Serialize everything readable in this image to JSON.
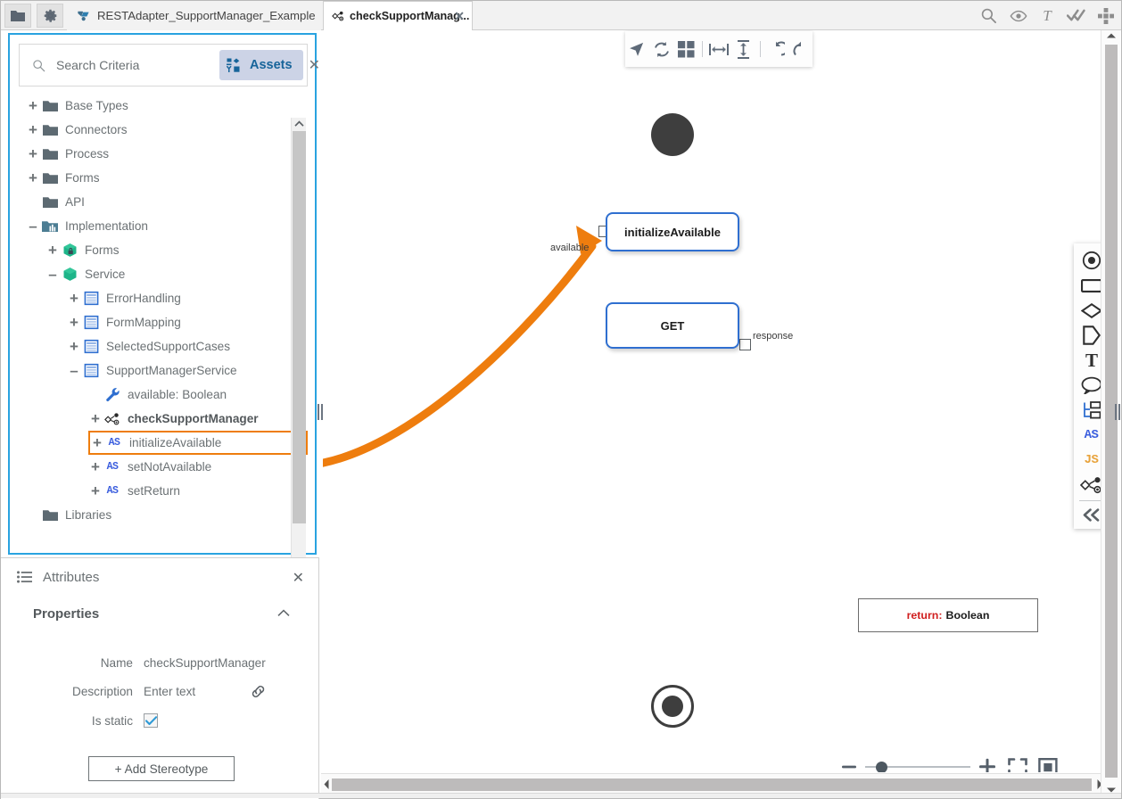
{
  "window": {
    "toolbar_buttons": [
      {
        "name": "folder-icon",
        "label": ""
      },
      {
        "name": "gear-icon",
        "label": ""
      }
    ],
    "project_tab": {
      "label": "RESTAdapter_SupportManager_Example",
      "icon": "project-icon"
    },
    "document_tab": {
      "label": "checkSupportManag...",
      "icon": "service-flow-icon",
      "close": "✕"
    },
    "top_right_icons": [
      "search-icon",
      "eye-icon",
      "text-icon",
      "double-check-icon",
      "move-icon"
    ]
  },
  "explorer": {
    "search": {
      "placeholder": "Search Criteria",
      "value": "",
      "assets_label": "Assets",
      "close": "✕"
    },
    "tree": [
      {
        "toggle": "+",
        "icon": "folder-icon",
        "label": "Base Types",
        "indent": 0,
        "bold": false,
        "selected": false
      },
      {
        "toggle": "+",
        "icon": "folder-icon",
        "label": "Connectors",
        "indent": 0,
        "bold": false,
        "selected": false
      },
      {
        "toggle": "+",
        "icon": "folder-icon",
        "label": "Process",
        "indent": 0,
        "bold": false,
        "selected": false
      },
      {
        "toggle": "+",
        "icon": "folder-icon",
        "label": "Forms",
        "indent": 0,
        "bold": false,
        "selected": false
      },
      {
        "toggle": "",
        "icon": "folder-icon",
        "label": "API",
        "indent": 0,
        "bold": false,
        "selected": false
      },
      {
        "toggle": "–",
        "icon": "folder-impl-icon",
        "label": "Implementation",
        "indent": 0,
        "bold": false,
        "selected": false
      },
      {
        "toggle": "+",
        "icon": "cube-lock-icon",
        "label": "Forms",
        "indent": 1,
        "bold": false,
        "selected": false
      },
      {
        "toggle": "–",
        "icon": "cube-icon",
        "label": "Service",
        "indent": 1,
        "bold": false,
        "selected": false
      },
      {
        "toggle": "+",
        "icon": "service-icon",
        "label": "ErrorHandling",
        "indent": 2,
        "bold": false,
        "selected": false
      },
      {
        "toggle": "+",
        "icon": "service-icon",
        "label": "FormMapping",
        "indent": 2,
        "bold": false,
        "selected": false
      },
      {
        "toggle": "+",
        "icon": "service-icon",
        "label": "SelectedSupportCases",
        "indent": 2,
        "bold": false,
        "selected": false
      },
      {
        "toggle": "–",
        "icon": "service-icon",
        "label": "SupportManagerService",
        "indent": 2,
        "bold": false,
        "selected": false
      },
      {
        "toggle": "",
        "icon": "wrench-icon",
        "label": "available: Boolean",
        "indent": 3,
        "bold": false,
        "selected": false
      },
      {
        "toggle": "+",
        "icon": "flow-icon",
        "label": "checkSupportManager",
        "indent": 3,
        "bold": true,
        "selected": false
      },
      {
        "toggle": "+",
        "icon": "as-icon",
        "label": "initializeAvailable",
        "indent": 3,
        "bold": false,
        "selected": true
      },
      {
        "toggle": "+",
        "icon": "as-icon",
        "label": "setNotAvailable",
        "indent": 3,
        "bold": false,
        "selected": false
      },
      {
        "toggle": "+",
        "icon": "as-icon",
        "label": "setReturn",
        "indent": 3,
        "bold": false,
        "selected": false
      },
      {
        "toggle": "",
        "icon": "folder-icon",
        "label": "Libraries",
        "indent": 0,
        "bold": false,
        "selected": false
      }
    ]
  },
  "attributes": {
    "title": "Attributes",
    "close": "✕",
    "section_title": "Properties",
    "fields": [
      {
        "label": "Name",
        "value": "checkSupportManager"
      },
      {
        "label": "Description",
        "value": "Enter text"
      },
      {
        "label": "Is static",
        "value": "checked"
      }
    ],
    "add_stereotype_label": "+ Add Stereotype"
  },
  "canvas": {
    "toolbar_icons": [
      "pointer-icon",
      "sync-icon",
      "grid-icon",
      "align-horizontal-icon",
      "align-vertical-icon",
      "undo-icon",
      "redo-icon"
    ],
    "nodes": [
      {
        "name": "start-node",
        "label": ""
      },
      {
        "name": "initialize-available-node",
        "label": "initializeAvailable"
      },
      {
        "name": "get-node",
        "label": "GET"
      },
      {
        "name": "end-node",
        "label": ""
      }
    ],
    "port_labels": {
      "available": "available",
      "response": "response"
    },
    "return_box": {
      "key": "return:",
      "value": "Boolean",
      "key_color": "#d01f1f"
    },
    "palette_icons": [
      "event-icon",
      "rectangle-icon",
      "diamond-icon",
      "pentagon-icon",
      "text-icon",
      "comment-icon",
      "subprocess-icon",
      "as-icon",
      "js-icon",
      "flow-icon",
      "collapse-icon"
    ],
    "zoom_controls": {
      "minus": "−",
      "plus": "+",
      "fit_screen": "fit-screen-icon",
      "fit_page": "fit-page-icon",
      "zoom_position_percent": 10
    }
  }
}
